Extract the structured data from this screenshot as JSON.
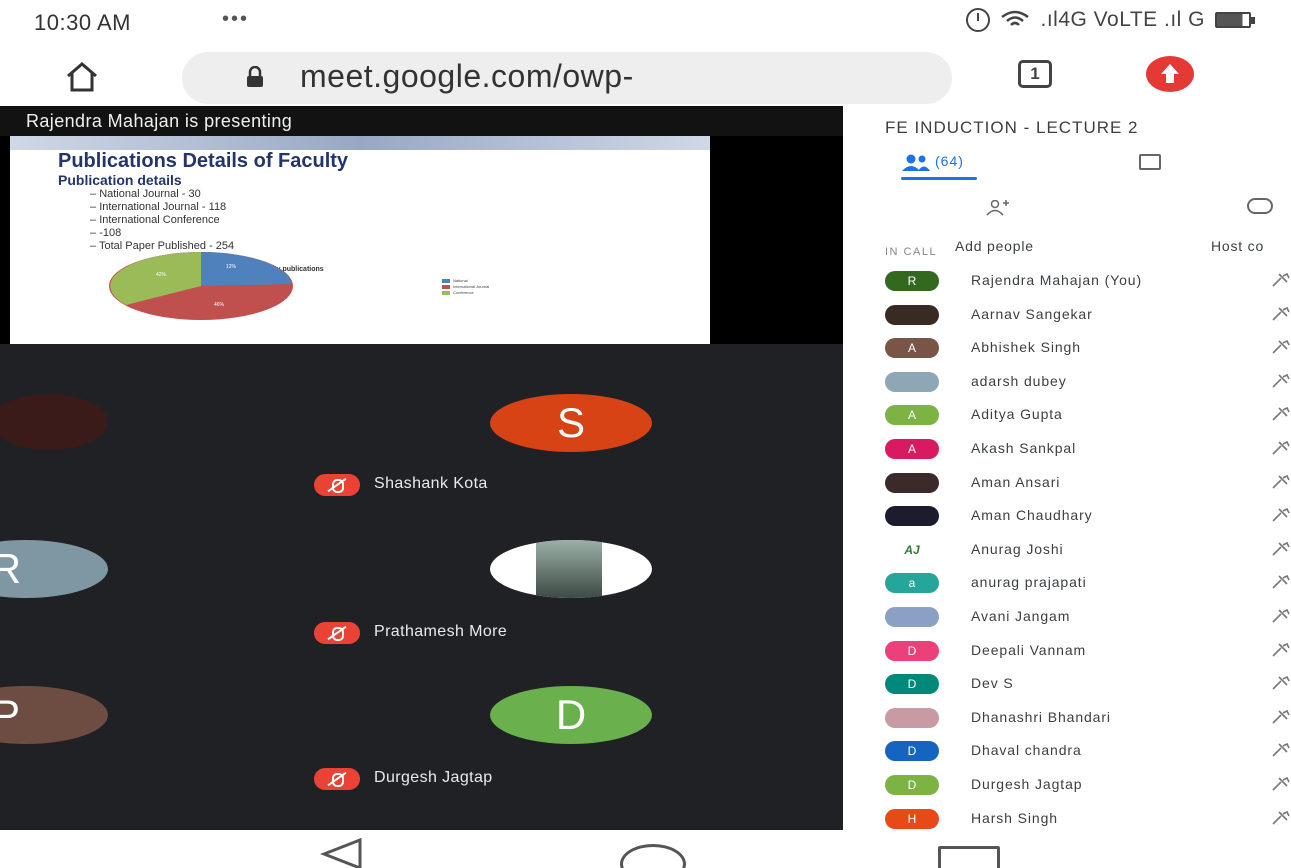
{
  "status_bar": {
    "time": "10:30 AM",
    "dots": "•••",
    "network": ".ıl4G VoLTE .ıl G"
  },
  "browser": {
    "url": "meet.google.com/owp-",
    "tab_count": "1"
  },
  "presentation": {
    "banner": "Rajendra Mahajan is presenting",
    "slide": {
      "title": "Publications Details of Faculty",
      "subtitle": "Publication details",
      "bullets": [
        "National Journal - 30",
        "International Journal - 118",
        "International Conference",
        "-108",
        "Total Paper Published - 254"
      ],
      "chart_title": "Faculty publications",
      "legend": [
        "National",
        "International Journal",
        "Conference"
      ],
      "pie_labels": [
        "12%",
        "46%",
        "42%"
      ]
    }
  },
  "tiles": [
    {
      "initial": "",
      "name": "",
      "color": "#202124"
    },
    {
      "initial": "S",
      "name": "Shashank Kota",
      "color": "#d84315"
    },
    {
      "initial": "R",
      "name": "",
      "color": "#7e97a3"
    },
    {
      "initial": "",
      "name": "Prathamesh More",
      "color": "#ffffff"
    },
    {
      "initial": "P",
      "name": "",
      "color": "#6d4c41"
    },
    {
      "initial": "D",
      "name": "Durgesh Jagtap",
      "color": "#6ab04c"
    }
  ],
  "panel": {
    "meeting_title": "FE INDUCTION - LECTURE 2",
    "people_count": "(64)",
    "add_people": "Add people",
    "host_controls": "Host co",
    "in_call": "IN CALL",
    "participants": [
      {
        "initial": "R",
        "name": "Rajendra Mahajan (You)",
        "color": "#33691e"
      },
      {
        "initial": "",
        "name": "Aarnav Sangekar",
        "color": "#3a2a24"
      },
      {
        "initial": "A",
        "name": "Abhishek Singh",
        "color": "#795548"
      },
      {
        "initial": "",
        "name": "adarsh dubey",
        "color": "#8ea7b4"
      },
      {
        "initial": "A",
        "name": "Aditya Gupta",
        "color": "#7cb342"
      },
      {
        "initial": "A",
        "name": "Akash Sankpal",
        "color": "#d81b60"
      },
      {
        "initial": "",
        "name": "Aman Ansari",
        "color": "#3b2a2a"
      },
      {
        "initial": "",
        "name": "Aman Chaudhary",
        "color": "#1c1c2e"
      },
      {
        "initial": "AJ",
        "name": "Anurag Joshi",
        "color": "#ffffff"
      },
      {
        "initial": "a",
        "name": "anurag prajapati",
        "color": "#26a69a"
      },
      {
        "initial": "",
        "name": "Avani Jangam",
        "color": "#8aa0c4"
      },
      {
        "initial": "D",
        "name": "Deepali Vannam",
        "color": "#ec407a"
      },
      {
        "initial": "D",
        "name": "Dev S",
        "color": "#00897b"
      },
      {
        "initial": "",
        "name": "Dhanashri Bhandari",
        "color": "#c79aa4"
      },
      {
        "initial": "D",
        "name": "Dhaval chandra",
        "color": "#1565c0"
      },
      {
        "initial": "D",
        "name": "Durgesh Jagtap",
        "color": "#7cb342"
      },
      {
        "initial": "H",
        "name": "Harsh Singh",
        "color": "#e64a19"
      }
    ]
  },
  "colors": {
    "accent": "#1a73e8",
    "mic_muted": "#ea4335",
    "stage_bg": "#202124"
  }
}
